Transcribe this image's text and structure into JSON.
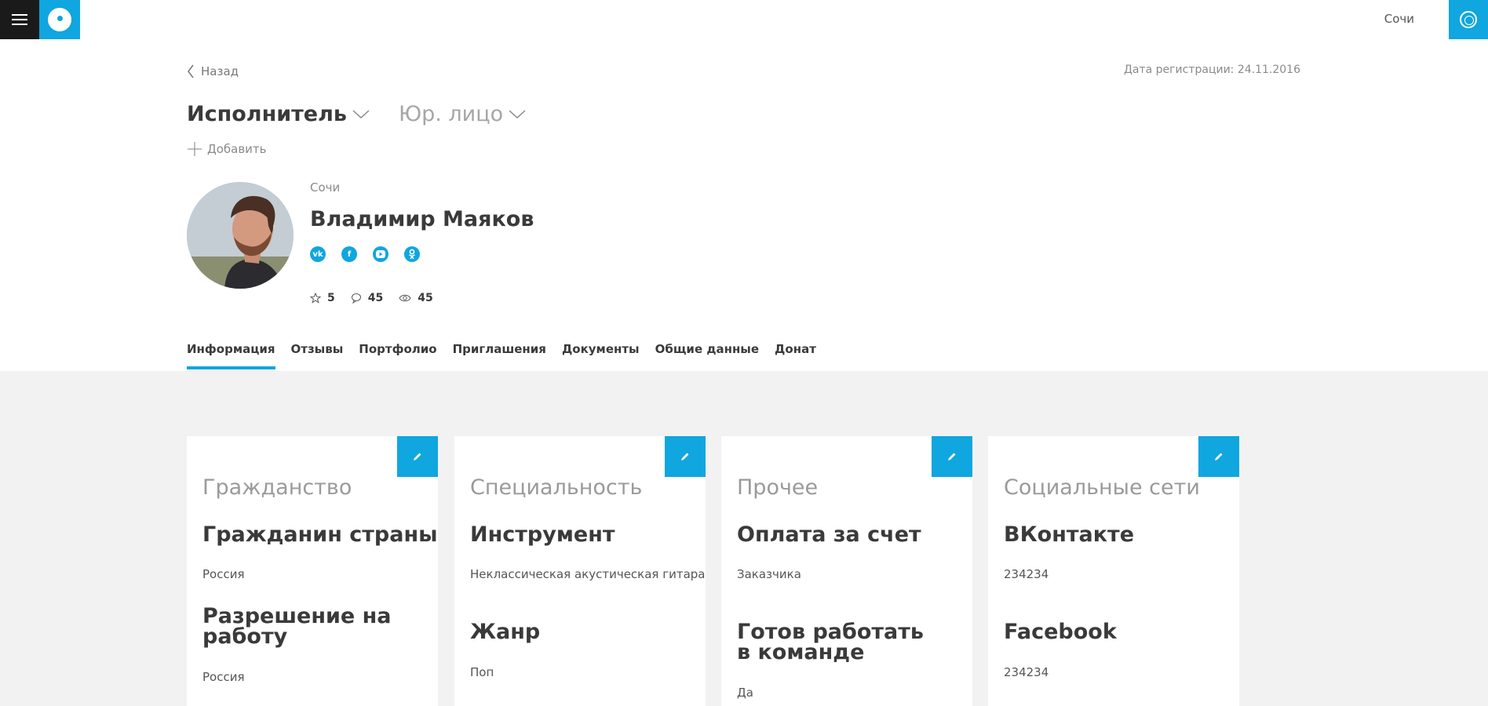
{
  "header": {
    "city": "Сочи",
    "colors": {
      "accent": "#10a6df",
      "menu_bg": "#1a1a1a"
    },
    "icons": [
      "menu-icon",
      "logo-icon",
      "user-icon"
    ]
  },
  "nav": {
    "back_label": "Назад"
  },
  "registration": {
    "label": "Дата регистрации: 24.11.2016"
  },
  "roles": {
    "primary": "Исполнитель",
    "secondary": "Юр. лицо"
  },
  "add": {
    "label": "Добавить"
  },
  "profile": {
    "city": "Сочи",
    "name": "Владимир Маяков",
    "socials": [
      "vk-icon",
      "facebook-icon",
      "youtube-icon",
      "odnoklassniki-icon"
    ],
    "stats": {
      "rating": "5",
      "comments": "45",
      "views": "45"
    }
  },
  "tabs": [
    "Информация",
    "Отзывы",
    "Портфолио",
    "Приглашения",
    "Документы",
    "Общие данные",
    "Донат"
  ],
  "active_tab": "Информация",
  "cards": [
    {
      "title": "Гражданство",
      "fields": [
        {
          "heading": "Гражданин страны",
          "value": "Россия"
        },
        {
          "heading": "Разрешение на работу",
          "value": "Россия"
        }
      ]
    },
    {
      "title": "Специальность",
      "fields": [
        {
          "heading": "Инструмент",
          "value": "Неклассическая акустическая гитара"
        },
        {
          "heading": "Жанр",
          "value": "Поп"
        }
      ]
    },
    {
      "title": "Прочее",
      "fields": [
        {
          "heading": "Оплата за счет",
          "value": "Заказчика"
        },
        {
          "heading": "Готов работать в команде",
          "value": "Да"
        }
      ]
    },
    {
      "title": "Социальные сети",
      "fields": [
        {
          "heading": "ВКонтакте",
          "value": "234234"
        },
        {
          "heading": "Facebook",
          "value": "234234"
        }
      ]
    }
  ]
}
